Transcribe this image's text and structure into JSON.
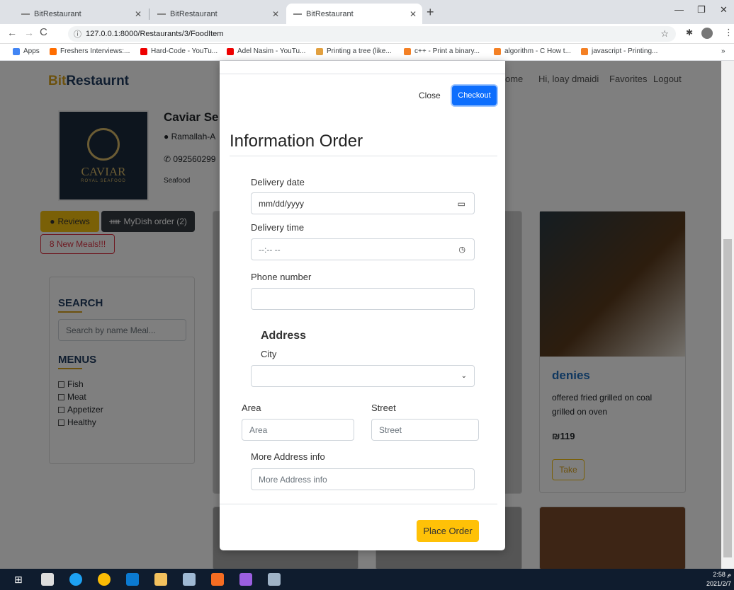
{
  "browser": {
    "tabs": [
      {
        "title": "BitRestaurant"
      },
      {
        "title": "BitRestaurant"
      },
      {
        "title": "BitRestaurant"
      }
    ],
    "url": "127.0.0.1:8000/Restaurants/3/FoodItem",
    "bookmarks": [
      "Apps",
      "Freshers Interviews:...",
      "Hard-Code - YouTu...",
      "Adel Nasim - YouTu...",
      "Printing a tree (like...",
      "c++ - Print a binary...",
      "algorithm - C How t...",
      "javascript - Printing..."
    ]
  },
  "site": {
    "brand_a": "Bit",
    "brand_b": "Restaurnt",
    "nav": [
      "ome",
      "Hi, loay dmaidi",
      "Favorites",
      "Logout"
    ],
    "logo_text": "CAVIAR",
    "logo_sub": "ROYAL SEAFOOD",
    "restaurant_name": "Caviar Se",
    "location": "Ramallah-A",
    "phone": "092560299",
    "category": "Seafood",
    "reviews_label": "Reviews",
    "mydish_label": "MyDish order (2)",
    "new_meals_label": "8 New Meals!!!",
    "search_title": "SEARCH",
    "search_placeholder": "Search by name Meal...",
    "menus_title": "MENUS",
    "menus": [
      "Fish",
      "Meat",
      "Appetizer",
      "Healthy"
    ],
    "dish": {
      "name": "denies",
      "desc1": "offered fried grilled on coal",
      "desc2": "grilled on oven",
      "price": "₪119",
      "take_label": "Take"
    }
  },
  "modal": {
    "close_label": "Close",
    "checkout_label": "Checkout",
    "title": "Information Order",
    "delivery_date_label": "Delivery date",
    "delivery_date_value": "mm/dd/yyyy",
    "delivery_time_label": "Delivery time",
    "delivery_time_value": "--:-- --",
    "phone_label": "Phone number",
    "address_heading": "Address",
    "city_label": "City",
    "area_label": "Area",
    "area_placeholder": "Area",
    "street_label": "Street",
    "street_placeholder": "Street",
    "more_label": "More Address info",
    "more_placeholder": "More Address info",
    "place_order_label": "Place Order"
  },
  "taskbar": {
    "time": "2:58 م",
    "date": "2021/2/7"
  }
}
